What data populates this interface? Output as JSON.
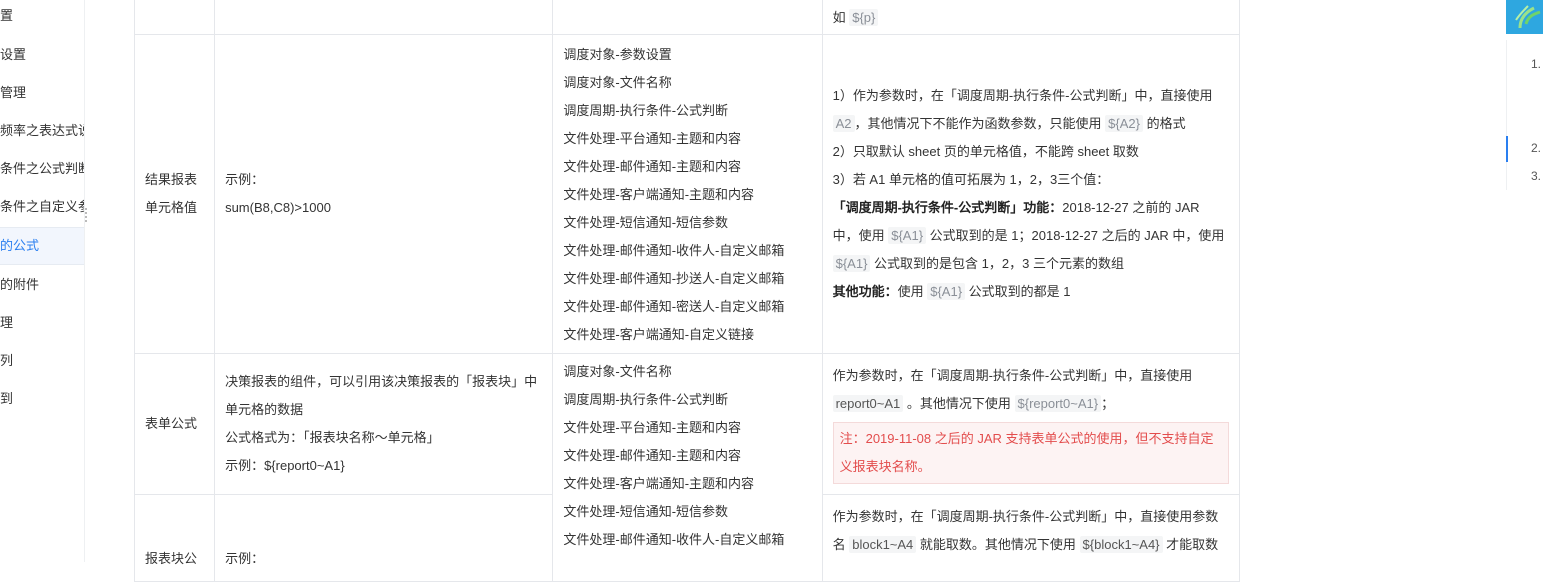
{
  "sidebar": {
    "items": [
      {
        "label": "置"
      },
      {
        "label": "设置"
      },
      {
        "label": "管理"
      },
      {
        "label": "频率之表达式说"
      },
      {
        "label": "条件之公式判断"
      },
      {
        "label": "条件之自定义参"
      },
      {
        "label": "的公式"
      },
      {
        "label": "的附件"
      },
      {
        "label": "理"
      },
      {
        "label": "列"
      },
      {
        "label": "到"
      }
    ]
  },
  "table": {
    "top_row": {
      "d_prefix": "如 ",
      "d_code": "${p}"
    },
    "row_cell": {
      "a": "结果报表单元格值",
      "b_example_label": "示例：",
      "b_example_value": "sum(B8,C8)>1000",
      "c_items": [
        "调度对象-参数设置",
        "调度对象-文件名称",
        "调度周期-执行条件-公式判断",
        "文件处理-平台通知-主题和内容",
        "文件处理-邮件通知-主题和内容",
        "文件处理-客户端通知-主题和内容",
        "文件处理-短信通知-短信参数",
        "文件处理-邮件通知-收件人-自定义邮箱",
        "文件处理-邮件通知-抄送人-自定义邮箱",
        "文件处理-邮件通知-密送人-自定义邮箱",
        "文件处理-客户端通知-自定义链接"
      ],
      "d": {
        "p1_a": "1）作为参数时，在「调度周期-执行条件-公式判断」中，直接使用 ",
        "p1_code1": "A2",
        "p1_b": "，其他情况下不能作为函数参数，只能使用 ",
        "p1_code2": "${A2}",
        "p1_c": " 的格式",
        "p2": "2）只取默认 sheet 页的单元格值，不能跨 sheet 取数",
        "p3": "3）若 A1 单元格的值可拓展为 1，2，3三个值：",
        "p4_bold": "「调度周期-执行条件-公式判断」功能：",
        "p4_a": "2018-12-27 之前的 JAR 中，使用 ",
        "p4_code1": "${A1}",
        "p4_b": " 公式取到的是 1；2018-12-27 之后的 JAR 中，使用 ",
        "p4_code2": "${A1}",
        "p4_c": " 公式取到的是包含 1，2，3 三个元素的数组",
        "p5_bold": "其他功能：",
        "p5_a": "使用 ",
        "p5_code": "${A1}",
        "p5_b": " 公式取到的都是 1"
      }
    },
    "row_form": {
      "a": "表单公式",
      "b_desc": "决策报表的组件，可以引用该决策报表的「报表块」中单元格的数据",
      "b_format": "公式格式为：「报表块名称～单元格」",
      "b_example": "示例：${report0~A1}",
      "c_items": [
        "调度对象-文件名称",
        "调度周期-执行条件-公式判断",
        "文件处理-平台通知-主题和内容",
        "文件处理-邮件通知-主题和内容",
        "文件处理-客户端通知-主题和内容",
        "文件处理-短信通知-短信参数",
        "文件处理-邮件通知-收件人-自定义邮箱"
      ],
      "d_a": "作为参数时，在「调度周期-执行条件-公式判断」中，直接使用 ",
      "d_code1": "report0~A1",
      "d_b": " 。其他情况下使用 ",
      "d_code2": "${report0~A1}",
      "d_c": "；",
      "note": "注：2019-11-08 之后的 JAR 支持表单公式的使用，但不支持自定义报表块名称。"
    },
    "row_block": {
      "a": "报表块公",
      "b_example_label": "示例：",
      "d_a": "作为参数时，在「调度周期-执行条件-公式判断」中，直接使用参数名 ",
      "d_code1": "block1~A4",
      "d_b": " 就能取数。其他情况下使用 ",
      "d_code2": "${block1~A4}",
      "d_c": " 才能取数"
    }
  },
  "toc": {
    "items": [
      {
        "label": "1."
      },
      {
        "label": "2."
      },
      {
        "label": "3."
      }
    ],
    "accent": "#2a7ff0",
    "banner_color": "#2ea7e0"
  }
}
